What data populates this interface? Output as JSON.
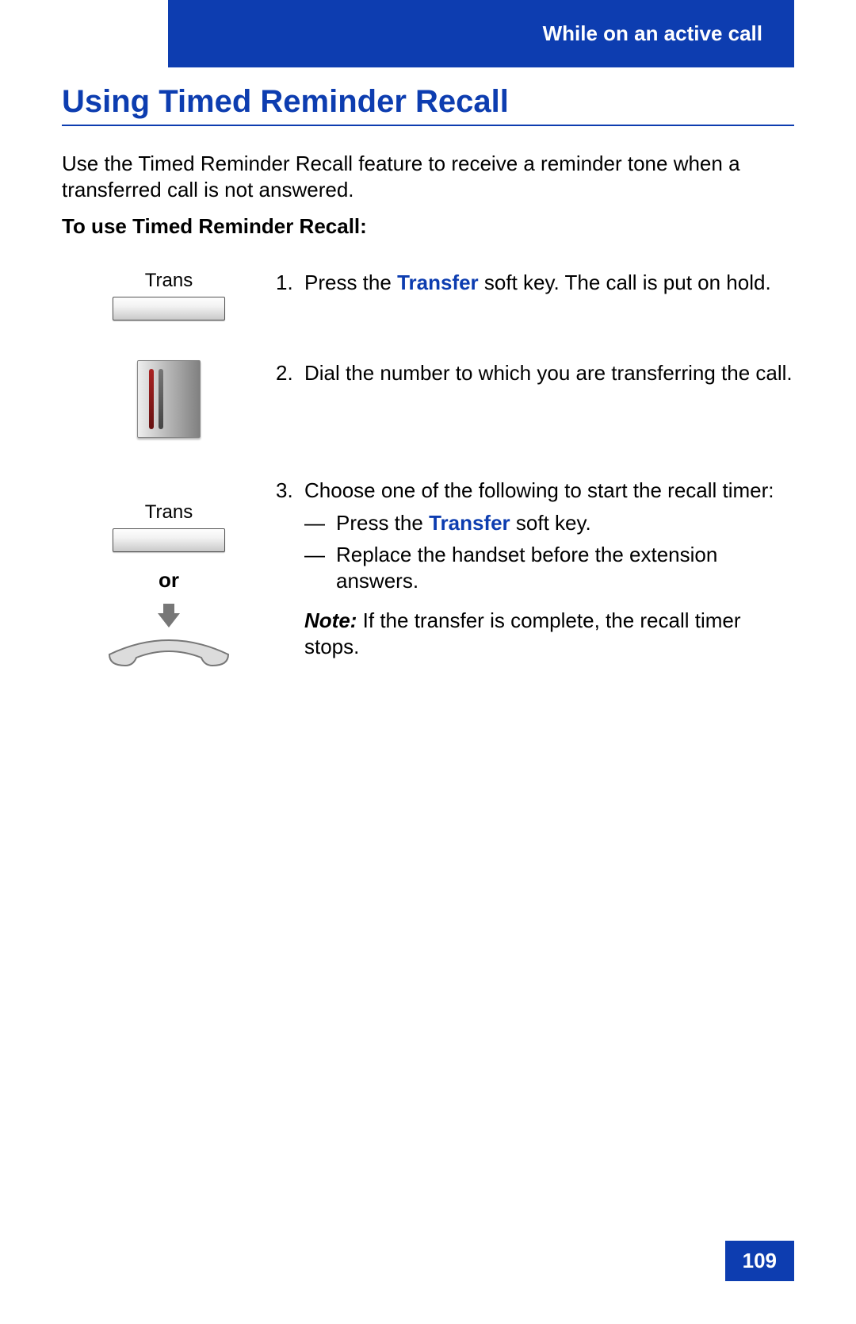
{
  "header": {
    "section": "While on an active call"
  },
  "title": "Using Timed Reminder Recall",
  "intro": "Use the Timed Reminder Recall feature to receive a reminder tone when a transferred call is not answered.",
  "subhead": "To use Timed Reminder Recall:",
  "softkey_label": "Trans",
  "or_label": "or",
  "steps": {
    "s1": {
      "num": "1.",
      "pre": "Press the ",
      "key": "Transfer",
      "post": " soft key. The call is put on hold."
    },
    "s2": {
      "num": "2.",
      "text": "Dial the number to which you are transferring the call."
    },
    "s3": {
      "num": "3.",
      "lead": "Choose one of the following to start the recall timer:",
      "opt1_pre": "Press the ",
      "opt1_key": "Transfer",
      "opt1_post": " soft key.",
      "opt2": "Replace the handset before the extension answers.",
      "note_label": "Note:",
      "note_text": " If the transfer is complete, the recall timer stops."
    }
  },
  "page_number": "109"
}
